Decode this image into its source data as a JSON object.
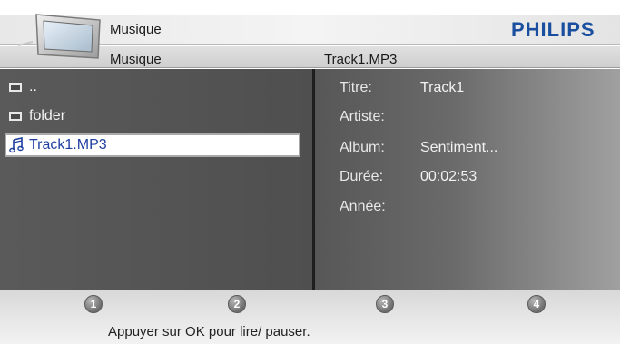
{
  "header": {
    "title": "Musique",
    "breadcrumb_left": "Musique",
    "breadcrumb_right": "Track1.MP3",
    "brand": "PHILIPS"
  },
  "file_list": {
    "items": [
      {
        "label": "..",
        "icon": "folder-icon",
        "selected": false
      },
      {
        "label": "folder",
        "icon": "folder-icon",
        "selected": false
      },
      {
        "label": "Track1.MP3",
        "icon": "music-note-icon",
        "selected": true
      }
    ]
  },
  "track_info": {
    "title_label": "Titre:",
    "title_value": "Track1",
    "artist_label": "Artiste:",
    "artist_value": "",
    "album_label": "Album:",
    "album_value": "Sentiment...",
    "duration_label": "Durée:",
    "duration_value": "00:02:53",
    "year_label": "Année:",
    "year_value": ""
  },
  "footer": {
    "buttons": [
      "1",
      "2",
      "3",
      "4"
    ],
    "hint": "Appuyer sur OK pour lire/ pauser."
  },
  "colors": {
    "brand": "#1a4fa0",
    "selection_text": "#1f3fa0"
  }
}
